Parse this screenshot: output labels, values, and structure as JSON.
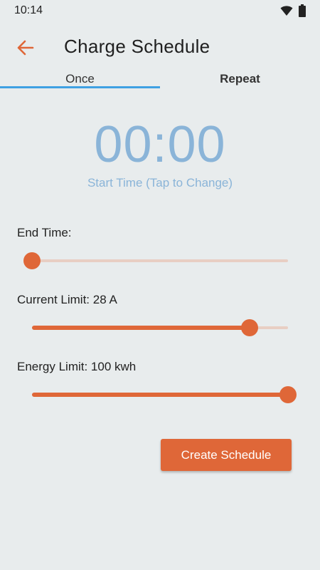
{
  "status_bar": {
    "time": "10:14"
  },
  "app_bar": {
    "title": "Charge Schedule"
  },
  "tabs": [
    {
      "label": "Once",
      "selected": true
    },
    {
      "label": "Repeat",
      "selected": false
    }
  ],
  "start_time": {
    "value": "00:00",
    "caption": "Start Time (Tap to Change)"
  },
  "sliders": {
    "end_time": {
      "label": "End Time:",
      "fraction": 0.0
    },
    "current_limit": {
      "label": "Current Limit: 28 A",
      "fraction": 0.85
    },
    "energy_limit": {
      "label": "Energy Limit: 100 kwh",
      "fraction": 1.0
    }
  },
  "actions": {
    "create_label": "Create Schedule"
  },
  "colors": {
    "accent": "#df6738",
    "tab_indicator": "#3fa1e3",
    "time_text": "#8ab4d8",
    "background": "#e8eced"
  },
  "icons": {
    "back": "arrow-left-icon",
    "wifi": "wifi-icon",
    "battery": "battery-icon"
  }
}
